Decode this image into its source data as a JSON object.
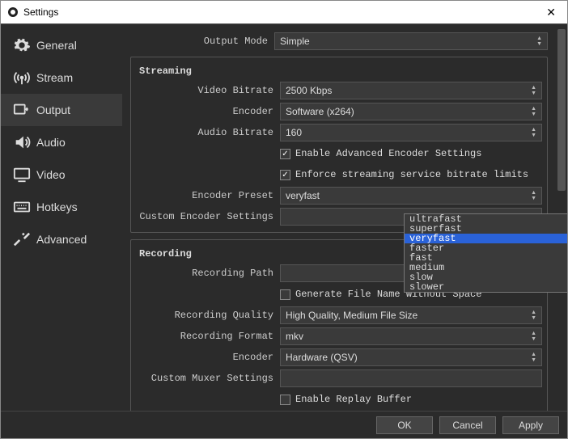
{
  "window": {
    "title": "Settings"
  },
  "sidebar": {
    "items": [
      {
        "label": "General"
      },
      {
        "label": "Stream"
      },
      {
        "label": "Output"
      },
      {
        "label": "Audio"
      },
      {
        "label": "Video"
      },
      {
        "label": "Hotkeys"
      },
      {
        "label": "Advanced"
      }
    ]
  },
  "main": {
    "output_mode_label": "Output Mode",
    "output_mode_value": "Simple"
  },
  "streaming": {
    "title": "Streaming",
    "video_bitrate_label": "Video Bitrate",
    "video_bitrate_value": "2500 Kbps",
    "encoder_label": "Encoder",
    "encoder_value": "Software (x264)",
    "audio_bitrate_label": "Audio Bitrate",
    "audio_bitrate_value": "160",
    "enable_advanced_label": "Enable Advanced Encoder Settings",
    "enable_advanced_checked": true,
    "enforce_limits_label": "Enforce streaming service bitrate limits",
    "enforce_limits_checked": true,
    "encoder_preset_label": "Encoder Preset",
    "encoder_preset_value": "veryfast",
    "custom_encoder_label": "Custom Encoder Settings",
    "custom_encoder_value": ""
  },
  "preset_options": [
    {
      "label": "ultrafast",
      "highlight": false
    },
    {
      "label": "superfast",
      "highlight": false
    },
    {
      "label": "veryfast",
      "highlight": true
    },
    {
      "label": "faster",
      "highlight": false
    },
    {
      "label": "fast",
      "highlight": false
    },
    {
      "label": "medium",
      "highlight": false
    },
    {
      "label": "slow",
      "highlight": false
    },
    {
      "label": "slower",
      "highlight": false
    }
  ],
  "recording": {
    "title": "Recording",
    "path_label": "Recording Path",
    "path_value": "",
    "gen_filename_label": "Generate File Name without Space",
    "gen_filename_checked": false,
    "quality_label": "Recording Quality",
    "quality_value": "High Quality, Medium File Size",
    "format_label": "Recording Format",
    "format_value": "mkv",
    "encoder_label": "Encoder",
    "encoder_value": "Hardware (QSV)",
    "muxer_label": "Custom Muxer Settings",
    "muxer_value": "",
    "replay_buffer_label": "Enable Replay Buffer",
    "replay_buffer_checked": false
  },
  "footer": {
    "ok": "OK",
    "cancel": "Cancel",
    "apply": "Apply"
  }
}
